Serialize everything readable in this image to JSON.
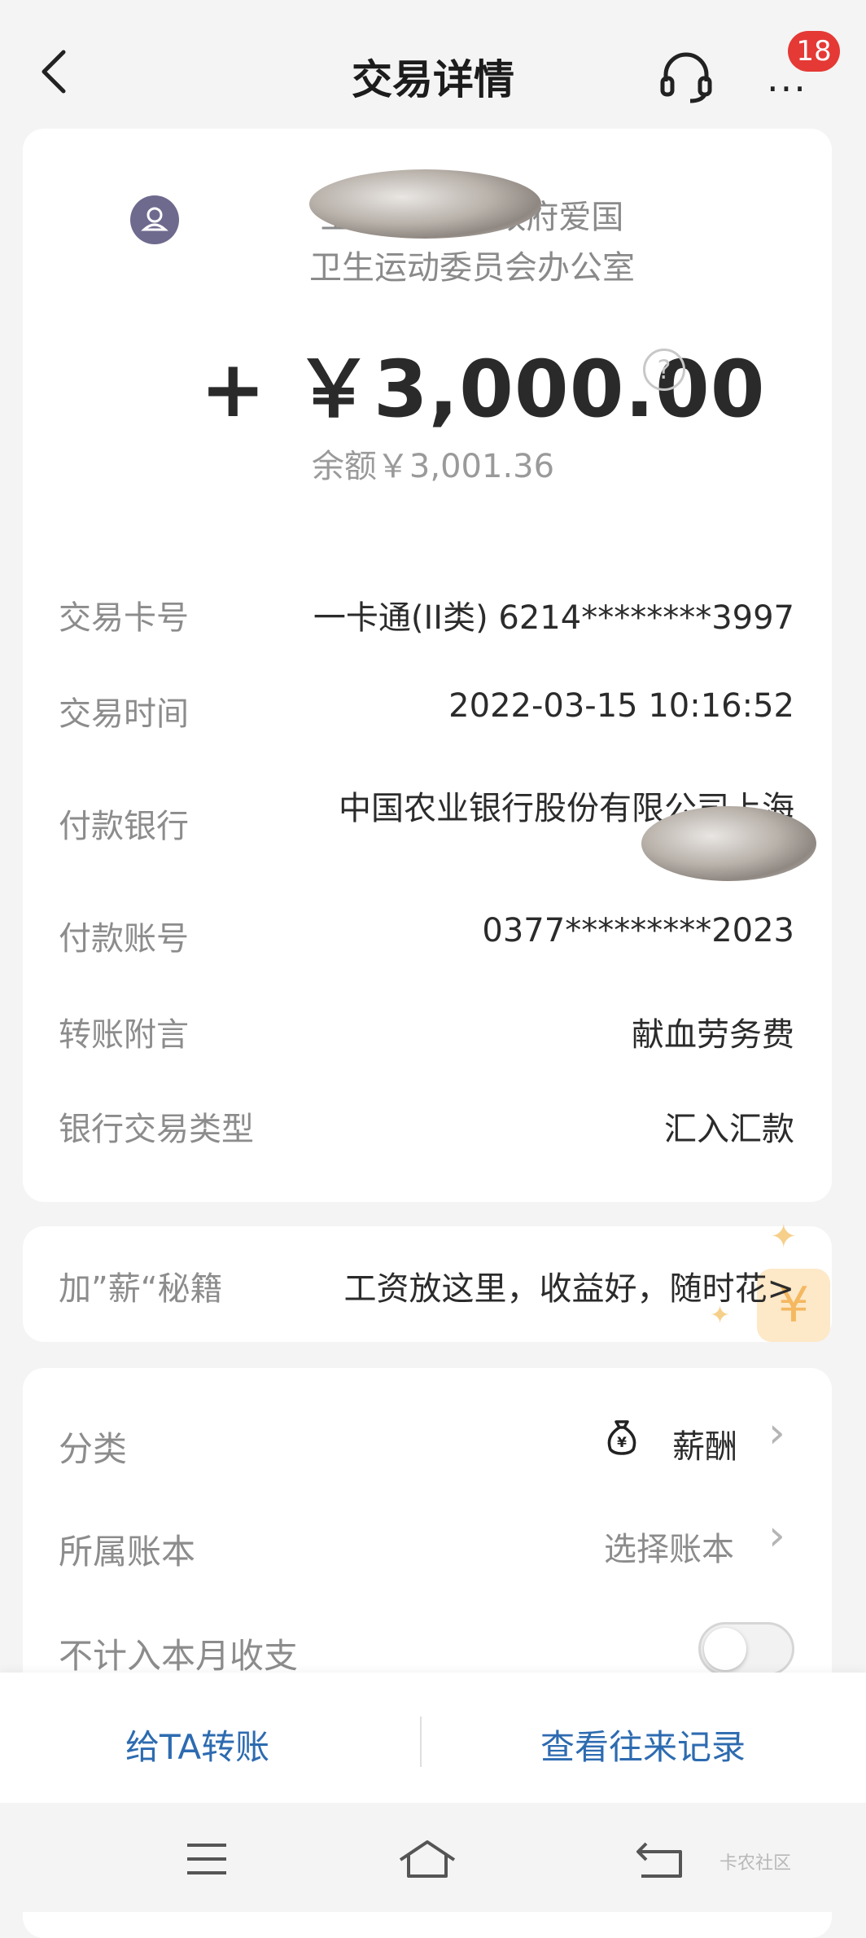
{
  "header": {
    "title": "交易详情",
    "notification_count": "18",
    "more_label": "···"
  },
  "transaction": {
    "payer_line1": "上海市 人民政府爱国",
    "payer_line2": "卫生运动委员会办公室",
    "amount": "+ ￥3,000.00",
    "balance": "余额￥3,001.36",
    "details": [
      {
        "label": "交易卡号",
        "value": "一卡通(II类) 6214********3997"
      },
      {
        "label": "交易时间",
        "value": "2022-03-15 10:16:52"
      },
      {
        "label": "付款银行",
        "value": "中国农业银行股份有限公司上海"
      },
      {
        "label": "付款账号",
        "value": "0377*********2023"
      },
      {
        "label": "转账附言",
        "value": "献血劳务费"
      },
      {
        "label": "银行交易类型",
        "value": "汇入汇款"
      }
    ]
  },
  "promo": {
    "label": "加”薪“秘籍",
    "text": "工资放这里，收益好，随时花>"
  },
  "classification": {
    "category_label": "分类",
    "category_value": "薪酬",
    "ledger_label": "所属账本",
    "ledger_value": "选择账本",
    "exclude_label": "不计入本月收支"
  },
  "actions": {
    "transfer": "给TA转账",
    "history": "查看往来记录"
  },
  "watermark": "卡农社区",
  "colors": {
    "accent": "#2d6bb0",
    "badge": "#e53935",
    "avatar": "#6e6a8e"
  }
}
